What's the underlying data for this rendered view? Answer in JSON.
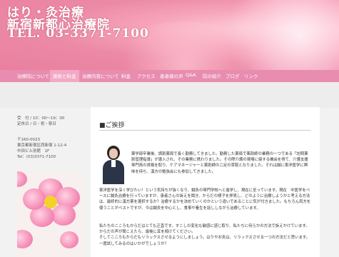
{
  "header": {
    "line1": "はり・灸治療",
    "line2": "新宿新都心治療院",
    "line3": "TEL. 03-3371-7100"
  },
  "nav": {
    "items": [
      "治療院について",
      "施術と料金",
      "治療内容について",
      "料金",
      "アクセス",
      "患者様の声",
      "Q&A",
      "院の紹介",
      "ブログ",
      "リンク"
    ]
  },
  "sidebar": {
    "hours": "受　付 / 10：00～19：00",
    "closed": "定休日 / 日・祝・祭日",
    "postal": "〒160-0023",
    "address": "東京都新宿区西新宿 1-12-4",
    "building": "中田ビル別館　1F",
    "tel": "Tel：(03)3371-7100"
  },
  "main": {
    "section_title": "■ご挨拶",
    "para1": "薬学部卒業後、調剤薬局で長く勤務してきました。勤務した薬局で薬剤師の業務の一つである「訪問薬剤管理指導」が導入され、その業務に携わりました。その際介護の現場に接する機会を得て、介護支援専門員の資格を取り、ケアマネージャーと薬剤師の二足の草鞋となりました。それは鍼に東洋医学に興味を持ち、漢方の勉強会にも参加してきました。",
    "para2": "東洋医学を深く学びたい！という気持ちが強くなり、鍼灸の専門学校へと進学し、現在に至っています。現在　中医学をベースに鍼灸治療を行っていますが、患者さんの訴えを聞き、からだの様子を拝見し、どのように治療しようかと考える方法は、最終的に漢方薬を選択するか？治療するかを決めていくのかという違いであることに気が付きました。もちろん両方を使うことがベストですが、今は鍼灸を中心とし、食事や養生を話ししながら治療しています。",
    "para3": "私たちのこころもからだはとても正直です。すこしの変化も敏感に感じ取り、私たちに何らかの方法で訴えかけています。からだの声が聞こえたら、最後に耳を傾けてください。\nそしてこころもからだもリラックスさせるようにしましょう。はりやお灸は、リラックスさせる一つの方法だと思います。一度試してみるのはいかがでしょうか？"
  },
  "colors": {
    "nav_bg": "#e88db0",
    "header_pink": "#ec8aa6"
  }
}
